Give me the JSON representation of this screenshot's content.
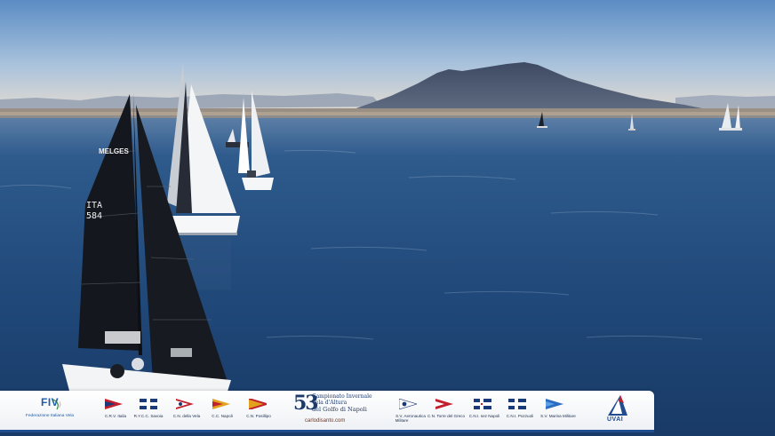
{
  "banner": {
    "fiv_logo": "FIV",
    "fiv_caption": "Federazione Italiana Vela",
    "clubs": [
      {
        "label": "C.R.V. Italia"
      },
      {
        "label": "R.Y.C.C. Savoia"
      },
      {
        "label": "C.N. della Vela"
      },
      {
        "label": "C.C. Napoli"
      },
      {
        "label": "C.N. Posillipo"
      },
      {
        "label": "S.V. Aeronautica"
      },
      {
        "label": "C.N. Torre del Greco"
      },
      {
        "label": "C.N.I. sez Napoli"
      },
      {
        "label": "C.N.I. Pozzuoli"
      },
      {
        "label": "S.V. Marina Militare"
      }
    ],
    "club_extra": "Militare",
    "championship": {
      "number": "53",
      "line1": "Campionato Invernale",
      "line2": "Vela d'Altura",
      "line3": "del Golfo di Napoli",
      "sponsor": "carlodisanto.com"
    },
    "uvai_logo": "UVAI"
  },
  "boats": {
    "sail_brand": "MELGES",
    "sail_country": "ITA",
    "sail_number": "584"
  },
  "colors": {
    "sky_top": "#5d8fc6",
    "sky_horizon": "#e7ded0",
    "sea": "#1e4578",
    "banner_blue": "#1f4d8f"
  }
}
